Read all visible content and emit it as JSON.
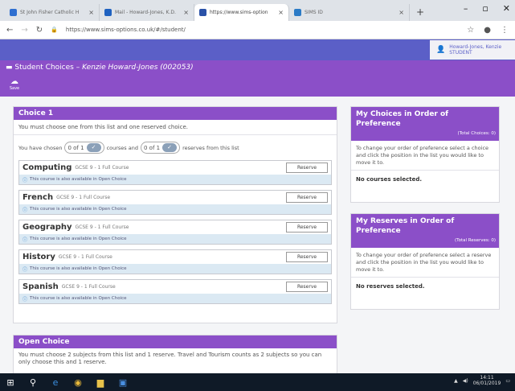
{
  "browser": {
    "tabs": [
      {
        "title": "St John Fisher Catholic H",
        "color": "#2f6fd0"
      },
      {
        "title": "Mail - Howard-Jones, K.D.",
        "color": "#1f62c0"
      },
      {
        "title": "https://www.sims-option",
        "color": "#2a52a8"
      },
      {
        "title": "SIMS ID",
        "color": "#2b7bc6"
      }
    ],
    "url": "https://www.sims-options.co.uk/#/student/"
  },
  "user": {
    "name": "Howard-Jones, Kenzie",
    "role": "STUDENT"
  },
  "page": {
    "title_prefix": "Student Choices – ",
    "student": "Kenzie Howard-Jones (002053)",
    "save_label": "Save"
  },
  "choice1": {
    "title": "Choice 1",
    "instruction": "You must choose one from this list and one reserved choice.",
    "counter": {
      "prefix": "You have chosen",
      "chosen": "0 of 1",
      "middle": "courses and",
      "reserves": "0 of 1",
      "suffix": "reserves from this list"
    },
    "courses": [
      {
        "name": "Computing",
        "desc": "GCSE 9 - 1 Full Course",
        "reserve": "Reserve",
        "note": "This course is also available in Open Choice"
      },
      {
        "name": "French",
        "desc": "GCSE 9 - 1 Full Course",
        "reserve": "Reserve",
        "note": "This course is also available in Open Choice"
      },
      {
        "name": "Geography",
        "desc": "GCSE 9 - 1 Full Course",
        "reserve": "Reserve",
        "note": "This course is also available in Open Choice"
      },
      {
        "name": "History",
        "desc": "GCSE 9 - 1 Full Course",
        "reserve": "Reserve",
        "note": "This course is also available in Open Choice"
      },
      {
        "name": "Spanish",
        "desc": "GCSE 9 - 1 Full Course",
        "reserve": "Reserve",
        "note": "This course is also available in Open Choice"
      }
    ]
  },
  "my_choices": {
    "title": "My Choices in Order of Preference",
    "total": "(Total Choices: 0)",
    "instruction": "To change your order of preference select a choice and click the position in the list you would like to move it to.",
    "empty": "No courses selected."
  },
  "my_reserves": {
    "title": "My Reserves in Order of Preference",
    "total": "(Total Reserves: 0)",
    "instruction": "To change your order of preference select a reserve and click the position in the list you would like to move it to.",
    "empty": "No reserves selected."
  },
  "open_choice": {
    "title": "Open Choice",
    "instruction": "You must choose 2 subjects from this list and 1 reserve. Travel and Tourism counts as 2 subjects so you can only choose this and 1 reserve."
  },
  "taskbar": {
    "time": "14:11",
    "date": "06/01/2019"
  },
  "colors": {
    "header_blue": "#5b5fc7",
    "panel_purple": "#8b4fc8",
    "note_blue": "#dbe9f3"
  }
}
